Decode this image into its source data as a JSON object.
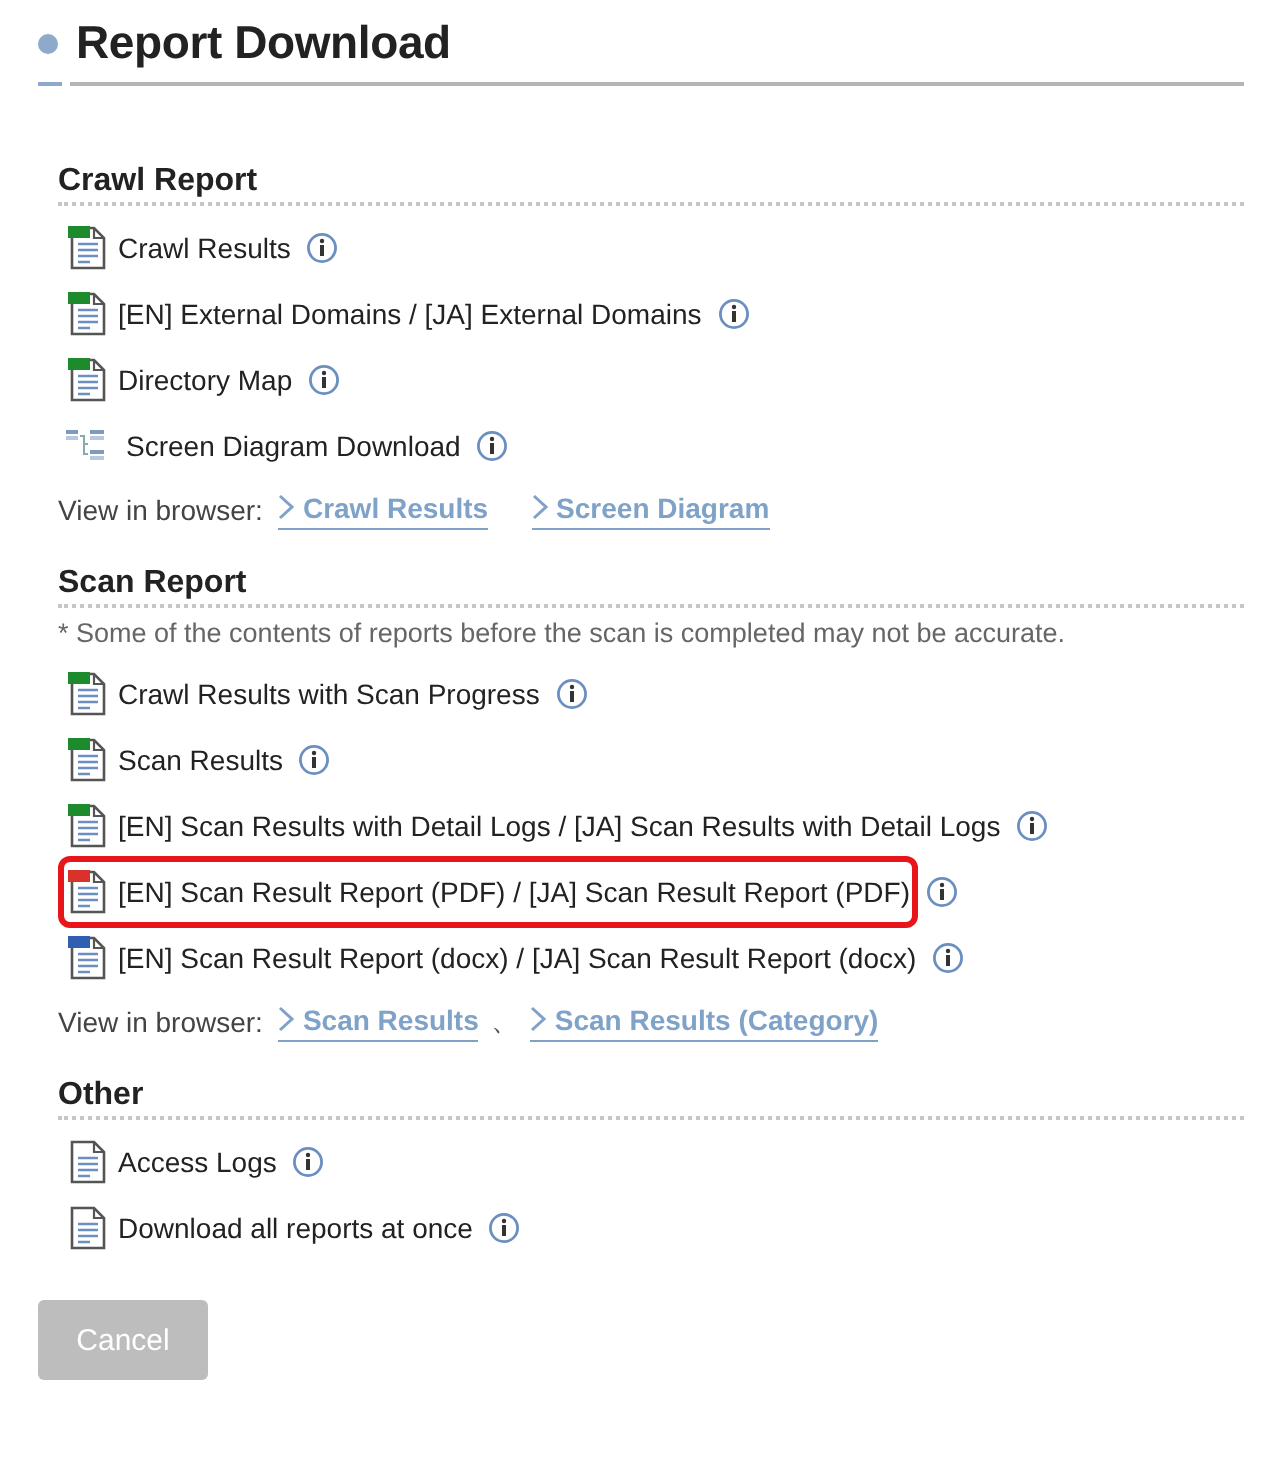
{
  "title": "Report Download",
  "sections": [
    {
      "heading": "Crawl Report",
      "items": [
        {
          "kind": "csv",
          "label": "Crawl Results",
          "highlighted": false
        },
        {
          "kind": "csv",
          "label": "[EN] External Domains / [JA] External Domains",
          "highlighted": false
        },
        {
          "kind": "csv",
          "label": "Directory Map",
          "highlighted": false
        },
        {
          "kind": "diagram",
          "label": "Screen Diagram Download",
          "highlighted": false
        }
      ],
      "view_in_browser": {
        "label": "View in browser:",
        "links": [
          {
            "label": "Crawl Results"
          },
          {
            "label": "Screen Diagram"
          }
        ]
      }
    },
    {
      "heading": "Scan Report",
      "note": "* Some of the contents of reports before the scan is completed may not be accurate.",
      "items": [
        {
          "kind": "csv",
          "label": "Crawl Results with Scan Progress",
          "highlighted": false
        },
        {
          "kind": "csv",
          "label": "Scan Results",
          "highlighted": false
        },
        {
          "kind": "xlsx",
          "label": "[EN] Scan Results with Detail Logs / [JA] Scan Results with Detail Logs",
          "highlighted": false
        },
        {
          "kind": "pdf",
          "label": "[EN] Scan Result Report (PDF) / [JA] Scan Result Report (PDF)",
          "highlighted": true
        },
        {
          "kind": "docx",
          "label": "[EN] Scan Result Report (docx) / [JA] Scan Result Report (docx)",
          "highlighted": false
        }
      ],
      "view_in_browser": {
        "label": "View in browser:",
        "separator": "、",
        "links": [
          {
            "label": "Scan Results"
          },
          {
            "label": "Scan Results (Category)"
          }
        ]
      }
    },
    {
      "heading": "Other",
      "items": [
        {
          "kind": "text",
          "label": "Access Logs",
          "highlighted": false
        },
        {
          "kind": "text",
          "label": "Download all reports at once",
          "highlighted": false
        }
      ]
    }
  ],
  "cancel_button": {
    "label": "Cancel",
    "disabled": true
  }
}
